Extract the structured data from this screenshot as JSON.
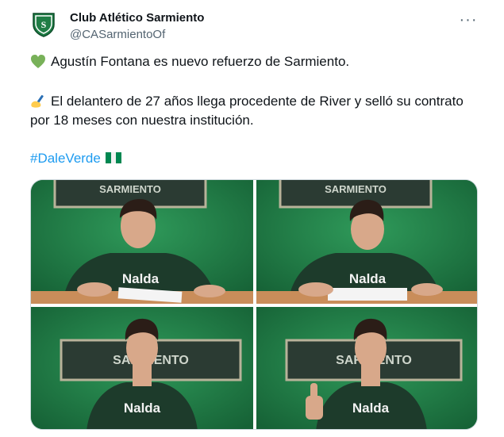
{
  "tweet": {
    "display_name": "Club Atlético Sarmiento",
    "handle": "@CASarmientoOf",
    "more_icon": "more-horizontal-icon",
    "paragraph1": "Agustín Fontana es nuevo refuerzo de Sarmiento.",
    "paragraph2_line1": "El delantero de 27 años llega procedente de River y selló su contrato",
    "paragraph2_line2": "por 18 meses con nuestra institución.",
    "hashtag": "#DaleVerde",
    "emojis": [
      "green-heart-icon",
      "writing-hand-icon",
      "nigeria-flag-icon"
    ]
  },
  "media": {
    "photos": [
      {
        "name": "photo-signing-smiling",
        "banner": "SARMIENTO",
        "shirt_text": "Nalda"
      },
      {
        "name": "photo-signing-writing",
        "banner": "SARMIENTO",
        "shirt_text": "Nalda"
      },
      {
        "name": "photo-portrait",
        "banner": "SARMIENTO",
        "shirt_text": "Nalda"
      },
      {
        "name": "photo-thumbs-up",
        "banner": "SARMIENTO",
        "shirt_text": "Nalda"
      }
    ]
  },
  "colors": {
    "hashtag": "#1d9bf0",
    "secondary_text": "#536471",
    "club_green": "#1f7d45"
  }
}
